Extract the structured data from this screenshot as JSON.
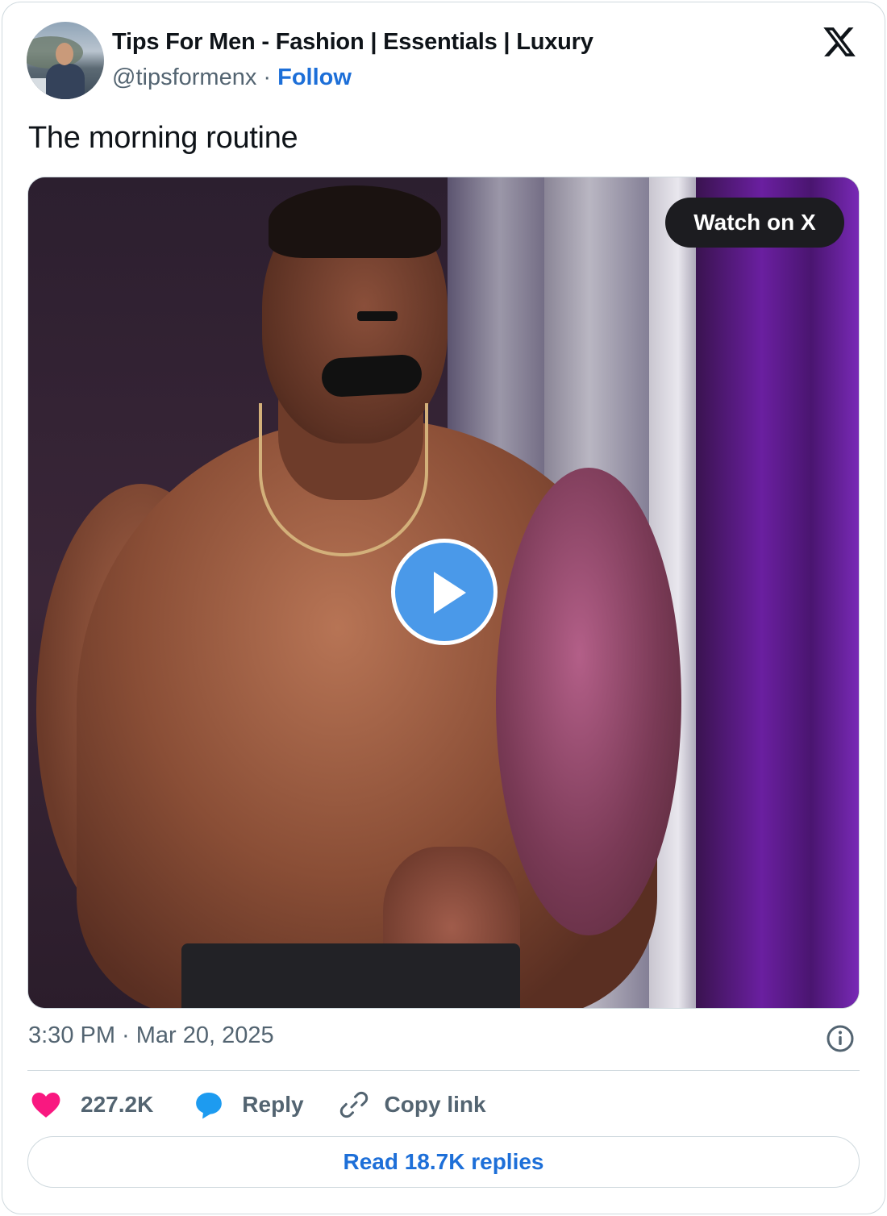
{
  "author": {
    "display_name": "Tips For Men - Fashion | Essentials | Luxury",
    "handle": "@tipsformenx",
    "separator": "·",
    "follow_label": "Follow"
  },
  "tweet": {
    "text": "The morning routine"
  },
  "media": {
    "watch_label": "Watch on X",
    "play_icon": "play-icon"
  },
  "meta": {
    "timestamp": "3:30 PM · Mar 20, 2025",
    "info_icon": "info-icon"
  },
  "actions": {
    "like_count": "227.2K",
    "reply_label": "Reply",
    "copy_label": "Copy link"
  },
  "footer": {
    "read_replies_label": "Read 18.7K replies"
  },
  "colors": {
    "accent": "#1d6fd8",
    "like": "#f91880",
    "reply_icon": "#1d9bf0",
    "muted": "#536471",
    "border": "#cfd9de"
  }
}
